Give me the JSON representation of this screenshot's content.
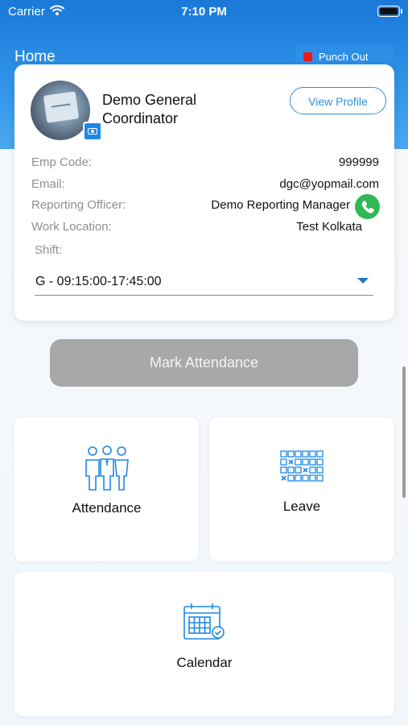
{
  "status_bar": {
    "carrier": "Carrier",
    "time": "7:10 PM"
  },
  "header": {
    "title": "Home",
    "punch_label": "Punch Out"
  },
  "profile": {
    "name": "Demo General Coordinator",
    "view_profile_label": "View Profile",
    "fields": [
      {
        "label": "Emp Code:",
        "value": "999999"
      },
      {
        "label": "Email:",
        "value": "dgc@yopmail.com"
      },
      {
        "label": "Reporting Officer:",
        "value": "Demo Reporting Manager"
      },
      {
        "label": "Work Location:",
        "value": "Test Kolkata"
      }
    ],
    "shift_label": "Shift:",
    "shift_value": "G - 09:15:00-17:45:00"
  },
  "mark_attendance_label": "Mark Attendance",
  "tiles": [
    {
      "label": "Attendance",
      "icon": "people-group-icon"
    },
    {
      "label": "Leave",
      "icon": "leave-grid-icon"
    },
    {
      "label": "Calendar",
      "icon": "calendar-check-icon"
    }
  ],
  "colors": {
    "header_blue": "#1a78d8",
    "accent": "#2f8fe0",
    "call_green": "#2fb855",
    "punch_red": "#f21818",
    "disabled_gray": "#a8a8a8",
    "icon_blue": "#1e88e5"
  }
}
